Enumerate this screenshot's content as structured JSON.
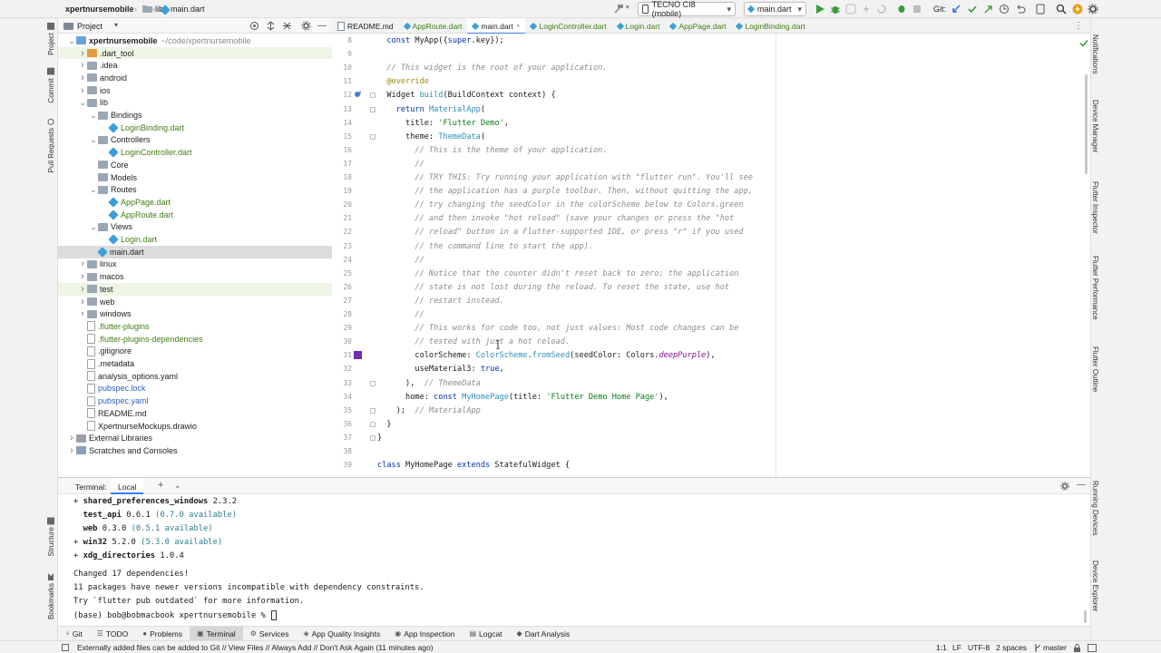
{
  "topbar": {
    "project": "xpertnursemobile",
    "crumb_lib": "lib",
    "crumb_file": "main.dart",
    "device": "TECNO CI8 (mobile)",
    "run_config": "main.dart",
    "git_label": "Git:"
  },
  "left_strip": {
    "project": "Project",
    "commit": "Commit",
    "pull_requests": "Pull Requests",
    "structure": "Structure",
    "bookmarks": "Bookmarks"
  },
  "right_strip": {
    "notifications": "Notifications",
    "device_manager": "Device Manager",
    "flutter_inspector": "Flutter Inspector",
    "flutter_performance": "Flutter Performance",
    "flutter_outline": "Flutter Outline",
    "running_devices": "Running Devices",
    "device_explorer": "Device Explorer"
  },
  "project_panel": {
    "title": "Project",
    "tree": [
      {
        "label": "xpertnursemobile",
        "extra": "~/code/xpertnursemobile",
        "kind": "root",
        "indent": 0,
        "arrow": "open"
      },
      {
        "label": ".dart_tool",
        "kind": "folder-orange",
        "indent": 1,
        "arrow": "closed",
        "color": "normal",
        "hl": true
      },
      {
        "label": ".idea",
        "kind": "folder",
        "indent": 1,
        "arrow": "closed",
        "color": "normal"
      },
      {
        "label": "android",
        "kind": "folder",
        "indent": 1,
        "arrow": "closed"
      },
      {
        "label": "ios",
        "kind": "folder",
        "indent": 1,
        "arrow": "closed"
      },
      {
        "label": "lib",
        "kind": "folder",
        "indent": 1,
        "arrow": "open"
      },
      {
        "label": "Bindings",
        "kind": "folder",
        "indent": 2,
        "arrow": "open"
      },
      {
        "label": "LoginBinding.dart",
        "kind": "dart",
        "indent": 3,
        "color": "green"
      },
      {
        "label": "Controllers",
        "kind": "folder",
        "indent": 2,
        "arrow": "open"
      },
      {
        "label": "LoginController.dart",
        "kind": "dart",
        "indent": 3,
        "color": "green"
      },
      {
        "label": "Core",
        "kind": "folder",
        "indent": 2
      },
      {
        "label": "Models",
        "kind": "folder",
        "indent": 2
      },
      {
        "label": "Routes",
        "kind": "folder",
        "indent": 2,
        "arrow": "open"
      },
      {
        "label": "AppPage.dart",
        "kind": "dart",
        "indent": 3,
        "color": "green"
      },
      {
        "label": "AppRoute.dart",
        "kind": "dart",
        "indent": 3,
        "color": "green"
      },
      {
        "label": "Views",
        "kind": "folder",
        "indent": 2,
        "arrow": "open"
      },
      {
        "label": "Login.dart",
        "kind": "dart",
        "indent": 3,
        "color": "green"
      },
      {
        "label": "main.dart",
        "kind": "dart",
        "indent": 2,
        "sel": true
      },
      {
        "label": "linux",
        "kind": "folder",
        "indent": 1,
        "arrow": "closed"
      },
      {
        "label": "macos",
        "kind": "folder",
        "indent": 1,
        "arrow": "closed"
      },
      {
        "label": "test",
        "kind": "folder",
        "indent": 1,
        "arrow": "closed",
        "hl": true
      },
      {
        "label": "web",
        "kind": "folder",
        "indent": 1,
        "arrow": "closed"
      },
      {
        "label": "windows",
        "kind": "folder",
        "indent": 1,
        "arrow": "closed"
      },
      {
        "label": ".flutter-plugins",
        "kind": "file",
        "indent": 1,
        "color": "green"
      },
      {
        "label": ".flutter-plugins-dependencies",
        "kind": "file",
        "indent": 1,
        "color": "green"
      },
      {
        "label": ".gitignore",
        "kind": "file",
        "indent": 1
      },
      {
        "label": ".metadata",
        "kind": "file",
        "indent": 1
      },
      {
        "label": "analysis_options.yaml",
        "kind": "file",
        "indent": 1
      },
      {
        "label": "pubspec.lock",
        "kind": "file",
        "indent": 1,
        "color": "blue"
      },
      {
        "label": "pubspec.yaml",
        "kind": "file",
        "indent": 1,
        "color": "blue"
      },
      {
        "label": "README.md",
        "kind": "file",
        "indent": 1
      },
      {
        "label": "XpertnurseMockups.drawio",
        "kind": "file",
        "indent": 1
      },
      {
        "label": "External Libraries",
        "kind": "lib",
        "indent": 0,
        "arrow": "closed"
      },
      {
        "label": "Scratches and Consoles",
        "kind": "scratch",
        "indent": 0,
        "arrow": "closed"
      }
    ]
  },
  "editor_tabs": [
    {
      "label": "README.md",
      "kind": "md"
    },
    {
      "label": "AppRoute.dart",
      "kind": "dart",
      "color": "green"
    },
    {
      "label": "main.dart",
      "kind": "dart",
      "active": true
    },
    {
      "label": "LoginController.dart",
      "kind": "dart",
      "color": "green"
    },
    {
      "label": "Login.dart",
      "kind": "dart",
      "color": "green"
    },
    {
      "label": "AppPage.dart",
      "kind": "dart",
      "color": "green"
    },
    {
      "label": "LoginBinding.dart",
      "kind": "dart",
      "color": "green"
    }
  ],
  "code_lines": [
    {
      "n": "8",
      "html": "  <span class=\"kw\">const</span> MyApp({<span class=\"kw\">super</span>.key});"
    },
    {
      "n": "9",
      "html": ""
    },
    {
      "n": "10",
      "html": "  <span class=\"cm\">// This widget is the root of your application.</span>"
    },
    {
      "n": "11",
      "html": "  <span class=\"an\">@override</span>"
    },
    {
      "n": "12",
      "html": "  Widget <span class=\"ty\">build</span>(BuildContext context) {"
    },
    {
      "n": "13",
      "html": "    <span class=\"kw\">return</span> <span class=\"ty\">MaterialApp</span>("
    },
    {
      "n": "14",
      "html": "      title: <span class=\"st\">'Flutter Demo'</span>,"
    },
    {
      "n": "15",
      "html": "      theme: <span class=\"ty\">ThemeData</span>("
    },
    {
      "n": "16",
      "html": "        <span class=\"cm\">// This is the theme of your application.</span>"
    },
    {
      "n": "17",
      "html": "        <span class=\"cm\">//</span>"
    },
    {
      "n": "18",
      "html": "        <span class=\"cm\">// TRY THIS: Try running your application with \"flutter run\". You'll see</span>"
    },
    {
      "n": "19",
      "html": "        <span class=\"cm\">// the application has a purple toolbar. Then, without quitting the app,</span>"
    },
    {
      "n": "20",
      "html": "        <span class=\"cm\">// try changing the seedColor in the colorScheme below to Colors.green</span>"
    },
    {
      "n": "21",
      "html": "        <span class=\"cm\">// and then invoke \"hot reload\" (save your changes or press the \"hot</span>"
    },
    {
      "n": "22",
      "html": "        <span class=\"cm\">// reload\" button in a Flutter-supported IDE, or press \"r\" if you used</span>"
    },
    {
      "n": "23",
      "html": "        <span class=\"cm\">// the command line to start the app).</span>"
    },
    {
      "n": "24",
      "html": "        <span class=\"cm\">//</span>"
    },
    {
      "n": "25",
      "html": "        <span class=\"cm\">// Notice that the counter didn't reset back to zero; the application</span>"
    },
    {
      "n": "26",
      "html": "        <span class=\"cm\">// state is not lost during the reload. To reset the state, use hot</span>"
    },
    {
      "n": "27",
      "html": "        <span class=\"cm\">// restart instead.</span>"
    },
    {
      "n": "28",
      "html": "        <span class=\"cm\">//</span>"
    },
    {
      "n": "29",
      "html": "        <span class=\"cm\">// This works for code too, not just values: Most code changes can be</span>"
    },
    {
      "n": "30",
      "html": "        <span class=\"cm\">// tested with just a hot reload.</span>"
    },
    {
      "n": "31",
      "html": "        colorScheme: <span class=\"ty\">ColorScheme</span>.<span class=\"ty\">fromSeed</span>(seedColor: Colors.<span class=\"pu\">deepPurple</span>),"
    },
    {
      "n": "32",
      "html": "        useMaterial3: <span class=\"kw\">true</span>,"
    },
    {
      "n": "33",
      "html": "      ),  <span class=\"cm\">// ThemeData</span>"
    },
    {
      "n": "34",
      "html": "      home: <span class=\"kw\">const</span> <span class=\"ty\">MyHomePage</span>(title: <span class=\"st\">'Flutter Demo Home Page'</span>),"
    },
    {
      "n": "35",
      "html": "    );  <span class=\"cm\">// MaterialApp</span>"
    },
    {
      "n": "36",
      "html": "  }"
    },
    {
      "n": "37",
      "html": "}"
    },
    {
      "n": "38",
      "html": ""
    },
    {
      "n": "39",
      "html": "<span class=\"kw\">class</span> MyHomePage <span class=\"kw\">extends</span> StatefulWidget {"
    }
  ],
  "terminal": {
    "title": "Terminal:",
    "tab": "Local",
    "lines": [
      {
        "pre": "+ ",
        "name": "shared_preferences_windows",
        "ver": " 2.3.2",
        "avail": ""
      },
      {
        "pre": "  ",
        "name": "test_api",
        "ver": " 0.6.1 ",
        "avail": "(0.7.0 available)"
      },
      {
        "pre": "  ",
        "name": "web",
        "ver": " 0.3.0 ",
        "avail": "(0.5.1 available)"
      },
      {
        "pre": "+ ",
        "name": "win32",
        "ver": " 5.2.0 ",
        "avail": "(5.3.0 available)"
      },
      {
        "pre": "+ ",
        "name": "xdg_directories",
        "ver": " 1.0.4",
        "avail": ""
      }
    ],
    "changed": "Changed 17 dependencies!",
    "newer": "11 packages have newer versions incompatible with dependency constraints.",
    "try": "Try `flutter pub outdated` for more information.",
    "prompt": "(base) bob@bobmacbook xpertnursemobile % "
  },
  "tool_windows": [
    {
      "label": "Git",
      "icon": "git-icon"
    },
    {
      "label": "TODO",
      "icon": "todo-icon"
    },
    {
      "label": "Problems",
      "icon": "problems-icon"
    },
    {
      "label": "Terminal",
      "icon": "terminal-icon",
      "active": true
    },
    {
      "label": "Services",
      "icon": "services-icon"
    },
    {
      "label": "App Quality Insights",
      "icon": "app-quality-icon"
    },
    {
      "label": "App Inspection",
      "icon": "app-inspection-icon"
    },
    {
      "label": "Logcat",
      "icon": "logcat-icon"
    },
    {
      "label": "Dart Analysis",
      "icon": "dart-analysis-icon"
    }
  ],
  "status": {
    "message": "Externally added files can be added to Git // View Files // Always Add // Don't Ask Again (11 minutes ago)",
    "position": "1:1",
    "line_sep": "LF",
    "encoding": "UTF-8",
    "indent": "2 spaces",
    "branch": "master"
  },
  "colors": {
    "accent": "#3c7cf0",
    "swatch": "#6b2fb0",
    "selected_row": "#dcdcdc"
  }
}
